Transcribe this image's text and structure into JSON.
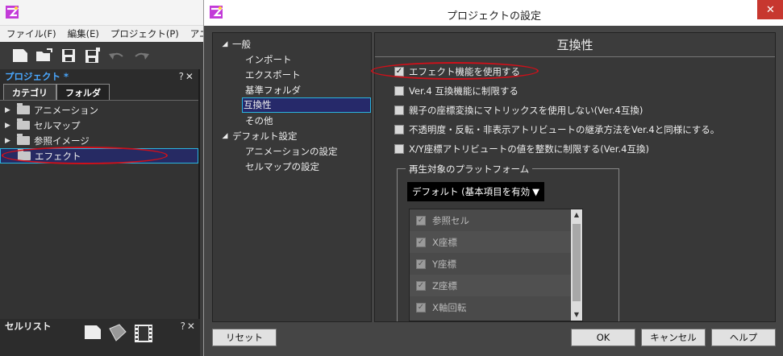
{
  "main_app": {
    "menu": [
      "ファイル(F)",
      "編集(E)",
      "プロジェクト(P)",
      "アニメー"
    ],
    "toolbar_icons": [
      "new-file-icon",
      "open-folder-icon",
      "save-icon",
      "save-all-icon",
      "undo-icon",
      "redo-icon"
    ],
    "project_panel": {
      "title": "プロジェクト *",
      "controls": "?✕",
      "tabs": [
        "カテゴリ",
        "フォルダ"
      ],
      "items": [
        {
          "label": "アニメーション",
          "expandable": true
        },
        {
          "label": "セルマップ",
          "expandable": true
        },
        {
          "label": "参照イメージ",
          "expandable": true
        },
        {
          "label": "エフェクト",
          "expandable": false,
          "selected": true
        }
      ]
    },
    "cell_panel": {
      "title": "セルリスト",
      "controls": "?✕"
    }
  },
  "dialog": {
    "title": "プロジェクトの設定",
    "close_glyph": "✕",
    "nav": [
      {
        "label": "一般",
        "level": 0,
        "expanded": true
      },
      {
        "label": "インポート",
        "level": 1
      },
      {
        "label": "エクスポート",
        "level": 1
      },
      {
        "label": "基準フォルダ",
        "level": 1
      },
      {
        "label": "互換性",
        "level": 1,
        "selected": true
      },
      {
        "label": "その他",
        "level": 1
      },
      {
        "label": "デフォルト設定",
        "level": 0,
        "expanded": true
      },
      {
        "label": "アニメーションの設定",
        "level": 1
      },
      {
        "label": "セルマップの設定",
        "level": 1
      }
    ],
    "content": {
      "header": "互換性",
      "options": [
        {
          "label": "エフェクト機能を使用する",
          "checked": true
        },
        {
          "label": "Ver.4 互換機能に制限する",
          "checked": false
        },
        {
          "label": "親子の座標変換にマトリックスを使用しない(Ver.4互換)",
          "checked": false
        },
        {
          "label": "不透明度・反転・非表示アトリビュートの継承方法をVer.4と同様にする。",
          "checked": false
        },
        {
          "label": "X/Y座標アトリビュートの値を整数に制限する(Ver.4互換)",
          "checked": false
        }
      ],
      "platform": {
        "legend": "再生対象のプラットフォーム",
        "selected": "デフォルト (基本項目を有効",
        "dropdown_glyph": "▼",
        "items": [
          {
            "label": "参照セル",
            "checked": true
          },
          {
            "label": "X座標",
            "checked": true
          },
          {
            "label": "Y座標",
            "checked": true
          },
          {
            "label": "Z座標",
            "checked": true
          },
          {
            "label": "X軸回転",
            "checked": true
          }
        ]
      }
    },
    "buttons": {
      "reset": "リセット",
      "ok": "OK",
      "cancel": "キャンセル",
      "help": "ヘルプ"
    }
  },
  "colors": {
    "annotation_red": "#d0101a",
    "selection_bg": "#26296a",
    "selection_border": "#2ab5e0",
    "title_accent": "#4aa8ff"
  }
}
